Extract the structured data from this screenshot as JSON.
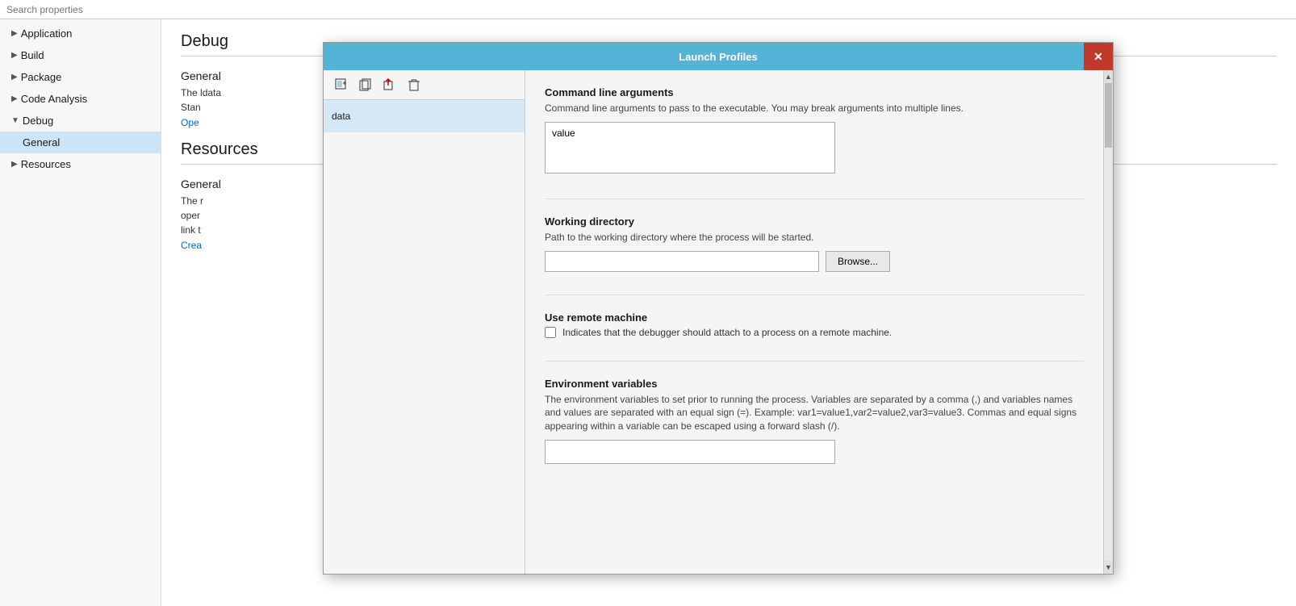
{
  "search": {
    "placeholder": "Search properties"
  },
  "sidebar": {
    "items": [
      {
        "id": "application",
        "label": "Application",
        "arrow": "▶",
        "indent": false,
        "active": false
      },
      {
        "id": "build",
        "label": "Build",
        "arrow": "▶",
        "indent": false,
        "active": false
      },
      {
        "id": "package",
        "label": "Package",
        "arrow": "▶",
        "indent": false,
        "active": false
      },
      {
        "id": "code-analysis",
        "label": "Code Analysis",
        "arrow": "▶",
        "indent": false,
        "active": false
      },
      {
        "id": "debug",
        "label": "Debug",
        "arrow": "▼",
        "indent": false,
        "active": false
      },
      {
        "id": "debug-general",
        "label": "General",
        "arrow": "",
        "indent": true,
        "active": true
      },
      {
        "id": "resources",
        "label": "Resources",
        "arrow": "▶",
        "indent": false,
        "active": false
      }
    ]
  },
  "content": {
    "debug_title": "Debug",
    "general_section": "General",
    "general_desc1": "The D",
    "general_desc2": "data",
    "general_desc3": "Stan",
    "open_link": "Ope",
    "resources_title": "Resources",
    "general2_section": "General",
    "general2_desc1": "The r",
    "general2_desc2": "oper",
    "general2_desc3": "link t",
    "create_link": "Crea"
  },
  "modal": {
    "title": "Launch Profiles",
    "close_label": "✕",
    "toolbar_buttons": [
      {
        "id": "btn1",
        "icon": "🗂",
        "title": "New"
      },
      {
        "id": "btn2",
        "icon": "📋",
        "title": "Copy"
      },
      {
        "id": "btn3",
        "icon": "📤",
        "title": "Export"
      },
      {
        "id": "btn4",
        "icon": "🗑",
        "title": "Delete"
      }
    ],
    "profile_name": "data",
    "sections": {
      "cmd_args": {
        "label": "Command line arguments",
        "desc": "Command line arguments to pass to the executable. You may break arguments into multiple lines.",
        "value": "value"
      },
      "working_dir": {
        "label": "Working directory",
        "desc": "Path to the working directory where the process will be started.",
        "value": "",
        "browse_label": "Browse..."
      },
      "remote_machine": {
        "label": "Use remote machine",
        "checkbox_checked": false,
        "checkbox_desc": "Indicates that the debugger should attach to a process on a remote machine."
      },
      "env_vars": {
        "label": "Environment variables",
        "desc": "The environment variables to set prior to running the process. Variables are separated by a comma (,) and variables names and values are separated with an equal sign (=). Example: var1=value1,var2=value2,var3=value3. Commas and equal signs appearing within a variable can be escaped using a forward slash (/).",
        "value": ""
      }
    }
  }
}
